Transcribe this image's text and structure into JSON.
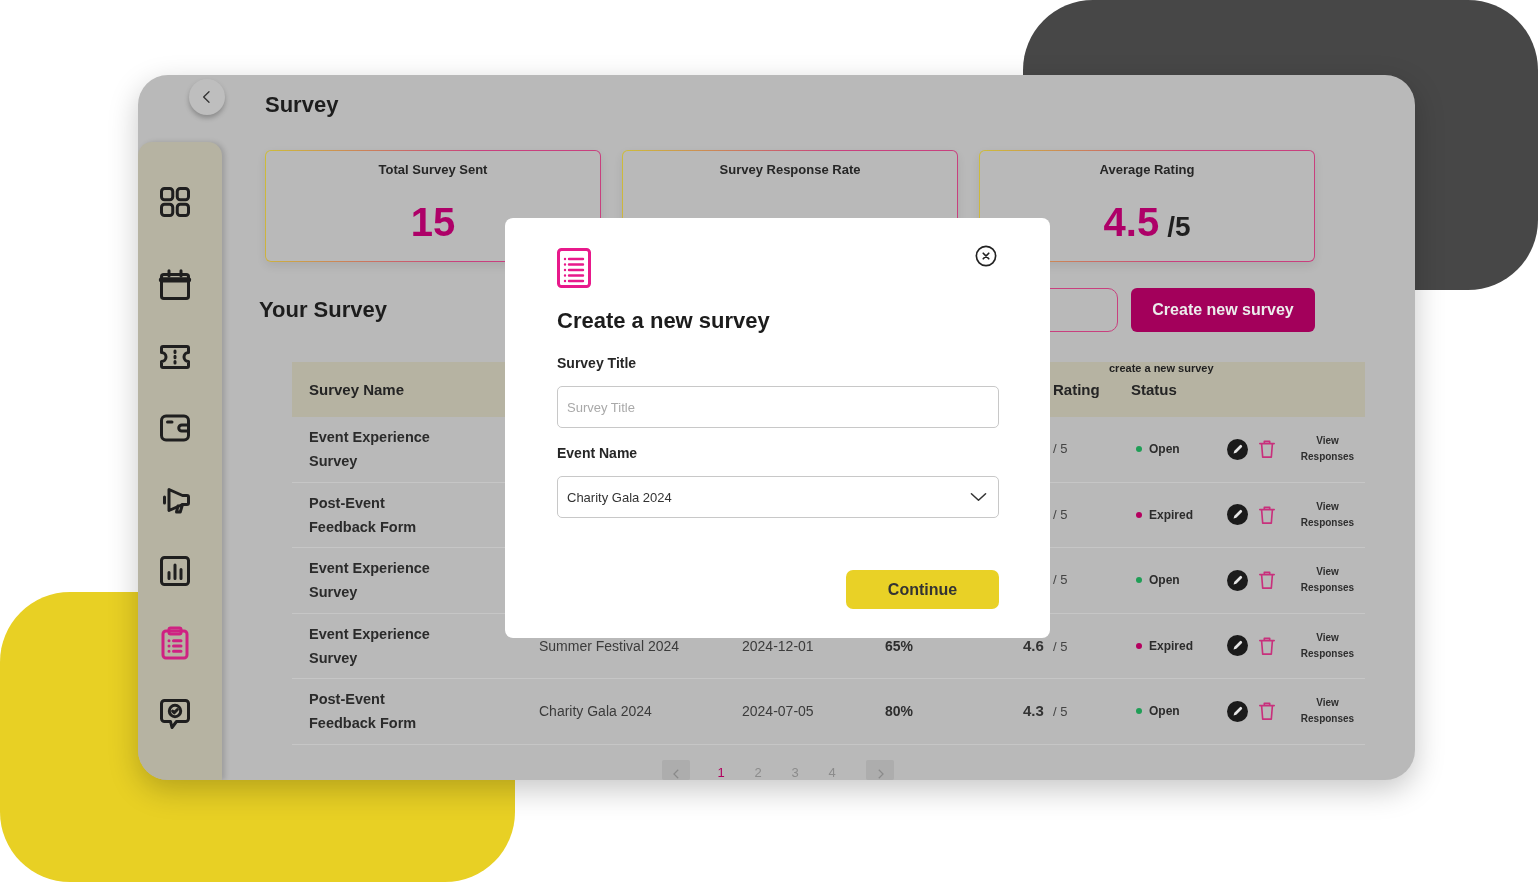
{
  "window": {
    "title": "Survey"
  },
  "sidebar": {
    "items": [
      {
        "selected": false
      },
      {
        "selected": false
      },
      {
        "selected": false
      },
      {
        "selected": false
      },
      {
        "selected": false
      },
      {
        "selected": false
      },
      {
        "selected": true
      },
      {
        "selected": false
      }
    ]
  },
  "stats": [
    {
      "label": "Total Survey Sent",
      "value": "15"
    },
    {
      "label": "Survey Response Rate"
    },
    {
      "label": "Average Rating",
      "value": "4.5",
      "unit": "/5"
    }
  ],
  "section_title": "Your Survey",
  "create_button": "Create new survey",
  "tooltip": "create a new survey",
  "table": {
    "columns": [
      "Survey Name",
      "Rating",
      "Status"
    ],
    "rows": [
      {
        "survey_name": "Event Experience Survey",
        "rating_scale": "/ 5",
        "status": {
          "label": "Open",
          "color": "#1f9e56"
        },
        "link": "View Responses"
      },
      {
        "survey_name": "Post-Event Feedback Form",
        "rating_scale": "/ 5",
        "status": {
          "label": "Expired",
          "color": "#b5005f"
        },
        "link": "View Responses"
      },
      {
        "survey_name": "Event Experience Survey",
        "rating_scale": "/ 5",
        "status": {
          "label": "Open",
          "color": "#1f9e56"
        },
        "link": "View Responses"
      },
      {
        "survey_name": "Event Experience Survey",
        "event": "Summer Festival 2024",
        "date": "2024-12-01",
        "response_rate": "65%",
        "rating": "4.6",
        "rating_scale": "/ 5",
        "status": {
          "label": "Expired",
          "color": "#b5005f"
        },
        "link": "View Responses"
      },
      {
        "survey_name": "Post-Event Feedback Form",
        "event": "Charity Gala 2024",
        "date": "2024-07-05",
        "response_rate": "80%",
        "rating": "4.3",
        "rating_scale": "/ 5",
        "status": {
          "label": "Open",
          "color": "#1f9e56"
        },
        "link": "View Responses"
      }
    ]
  },
  "pagination": {
    "pages": [
      {
        "label": "1",
        "selected": true
      },
      {
        "label": "2",
        "selected": false
      },
      {
        "label": "3",
        "selected": false
      },
      {
        "label": "4",
        "selected": false
      }
    ]
  },
  "dialog": {
    "title": "Create a new survey",
    "fields": [
      {
        "kind": "text",
        "label": "Survey Title",
        "placeholder": "Survey Title"
      },
      {
        "kind": "select",
        "label": "Event Name",
        "value": "Charity Gala 2024"
      }
    ],
    "button": "Continue"
  }
}
